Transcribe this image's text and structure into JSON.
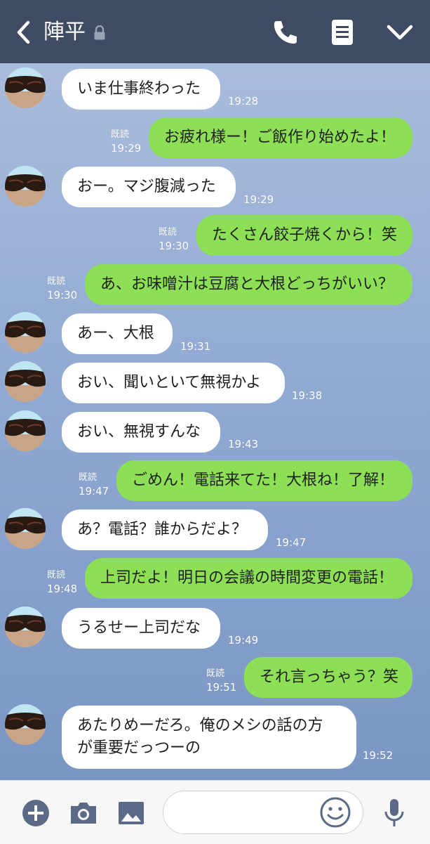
{
  "header": {
    "title": "陣平",
    "back_icon": "chevron-left-icon",
    "lock_icon": "lock-icon",
    "call_icon": "phone-icon",
    "menu_icon": "note-icon",
    "more_icon": "chevron-down-icon"
  },
  "colors": {
    "header_bg": "#3f4a63",
    "chat_bg": "#8ca6d0",
    "outgoing_bubble": "#8de055",
    "incoming_bubble": "#ffffff",
    "footer_bg": "#f7f7f7"
  },
  "messages": [
    {
      "dir": "in",
      "text": "いま仕事終わった",
      "time": "19:28"
    },
    {
      "dir": "out",
      "text": "お疲れ様ー！ご飯作り始めたよ！",
      "read": "既読",
      "time": "19:29"
    },
    {
      "dir": "in",
      "text": "おー。マジ腹減った",
      "time": "19:29"
    },
    {
      "dir": "out",
      "text": "たくさん餃子焼くから！笑",
      "read": "既読",
      "time": "19:30"
    },
    {
      "dir": "out",
      "text": "あ、お味噌汁は豆腐と大根どっちがいい？",
      "read": "既読",
      "time": "19:30"
    },
    {
      "dir": "in",
      "text": "あー、大根",
      "time": "19:31"
    },
    {
      "dir": "in",
      "text": "おい、聞いといて無視かよ",
      "time": "19:38"
    },
    {
      "dir": "in",
      "text": "おい、無視すんな",
      "time": "19:43"
    },
    {
      "dir": "out",
      "text": "ごめん！電話来てた！大根ね！了解！",
      "read": "既読",
      "time": "19:47"
    },
    {
      "dir": "in",
      "text": "あ？電話？誰からだよ？",
      "time": "19:47"
    },
    {
      "dir": "out",
      "text": "上司だよ！明日の会議の時間変更の電話！",
      "read": "既読",
      "time": "19:48"
    },
    {
      "dir": "in",
      "text": "うるせー上司だな",
      "time": "19:49"
    },
    {
      "dir": "out",
      "text": "それ言っちゃう？笑",
      "read": "既読",
      "time": "19:51"
    },
    {
      "dir": "in",
      "text": "あたりめーだろ。俺のメシの話の方\nが重要だっつーの",
      "time": "19:52"
    }
  ],
  "footer": {
    "add_icon": "plus-circle-icon",
    "camera_icon": "camera-icon",
    "image_icon": "image-icon",
    "input_value": "",
    "emoji_icon": "smiley-icon",
    "mic_icon": "microphone-icon"
  }
}
